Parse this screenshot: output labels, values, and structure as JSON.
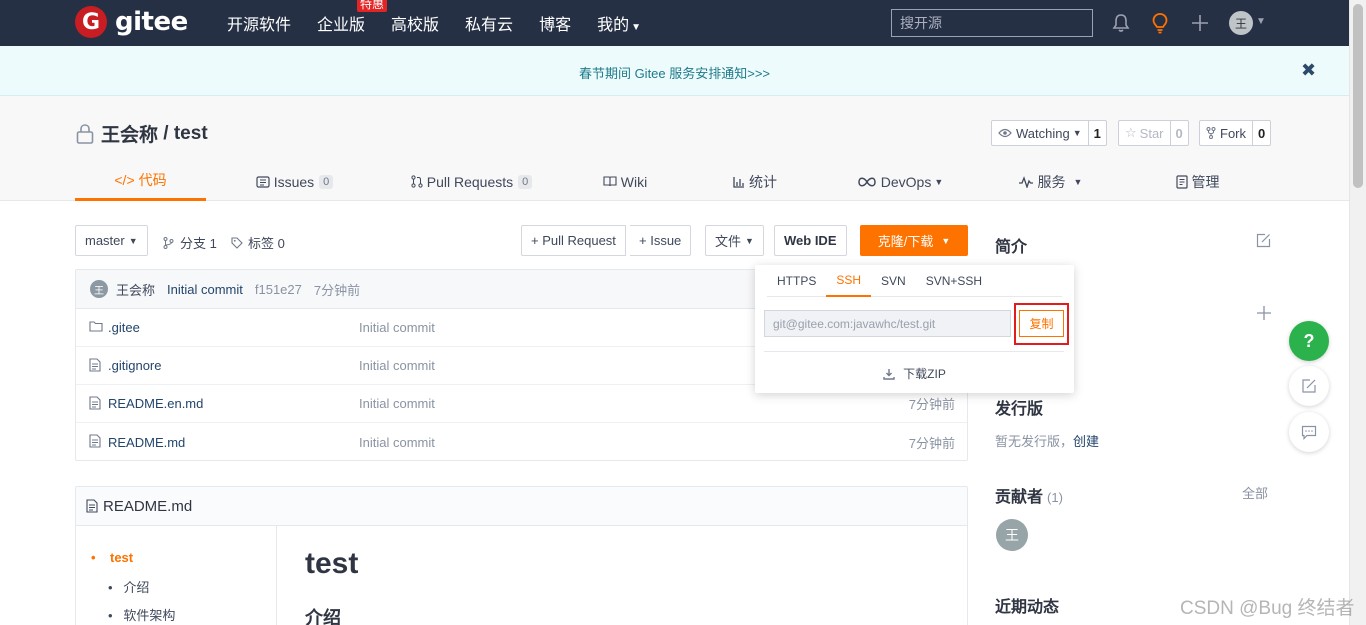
{
  "nav": {
    "logo_text": "gitee",
    "links": [
      "开源软件",
      "企业版",
      "高校版",
      "私有云",
      "博客",
      "我的"
    ],
    "special_badge": "特惠",
    "search_placeholder": "搜开源",
    "avatar_initial": "王"
  },
  "notice": {
    "text": "春节期间 Gitee 服务安排通知>>>",
    "close": "✖"
  },
  "repo": {
    "owner": "王会称",
    "separator": " / ",
    "name": "test",
    "watch_label": "Watching",
    "watch_count": "1",
    "star_label": "Star",
    "star_count": "0",
    "fork_label": "Fork",
    "fork_count": "0"
  },
  "tabs": [
    {
      "label": "代码",
      "icon": "code-icon",
      "active": true
    },
    {
      "label": "Issues",
      "icon": "issues-icon",
      "count": "0"
    },
    {
      "label": "Pull Requests",
      "icon": "pull-request-icon",
      "count": "0"
    },
    {
      "label": "Wiki",
      "icon": "book-icon"
    },
    {
      "label": "统计",
      "icon": "bar-chart-icon"
    },
    {
      "label": "DevOps",
      "icon": "infinity-icon",
      "dropdown": true
    },
    {
      "label": "服务",
      "icon": "pulse-icon",
      "dropdown": true
    },
    {
      "label": "管理",
      "icon": "settings-doc-icon"
    }
  ],
  "toolbar": {
    "branch": "master",
    "branches_label": "分支 1",
    "tags_label": "标签 0",
    "pull_request": "+ Pull Request",
    "issue": "+ Issue",
    "file": "文件",
    "web_ide": "Web IDE",
    "clone": "克隆/下载"
  },
  "latest_commit": {
    "avatar_initial": "王",
    "author": "王会称",
    "message": "Initial commit",
    "hash": "f151e27",
    "time": "7分钟前"
  },
  "files": [
    {
      "name": ".gitee",
      "type": "folder",
      "message": "Initial commit",
      "time": ""
    },
    {
      "name": ".gitignore",
      "type": "file",
      "message": "Initial commit",
      "time": ""
    },
    {
      "name": "README.en.md",
      "type": "file",
      "message": "Initial commit",
      "time": "7分钟前"
    },
    {
      "name": "README.md",
      "type": "file",
      "message": "Initial commit",
      "time": "7分钟前"
    }
  ],
  "clone_popup": {
    "tabs": [
      "HTTPS",
      "SSH",
      "SVN",
      "SVN+SSH"
    ],
    "active_tab": "SSH",
    "url": "git@gitee.com:javawhc/test.git",
    "copy": "复制",
    "download_zip": "下载ZIP"
  },
  "readme": {
    "filename": "README.md",
    "toc": [
      "test",
      "介绍",
      "软件架构"
    ],
    "h1": "test",
    "h2": "介绍"
  },
  "sidebar": {
    "intro_title": "简介",
    "release_title": "发行版",
    "release_text": "暂无发行版，",
    "release_create": "创建",
    "contributors_title": "贡献者",
    "contributors_count": "(1)",
    "contributors_all": "全部",
    "contributor_initial": "王",
    "activity_title": "近期动态"
  },
  "floating": {
    "help": "?"
  },
  "watermark": "CSDN @Bug 终结者",
  "colors": {
    "nav_bg": "#263045",
    "accent": "#fe7300",
    "brand_red": "#c71d23",
    "help_green": "#2bb24c",
    "highlight_red": "#e21c1c"
  }
}
